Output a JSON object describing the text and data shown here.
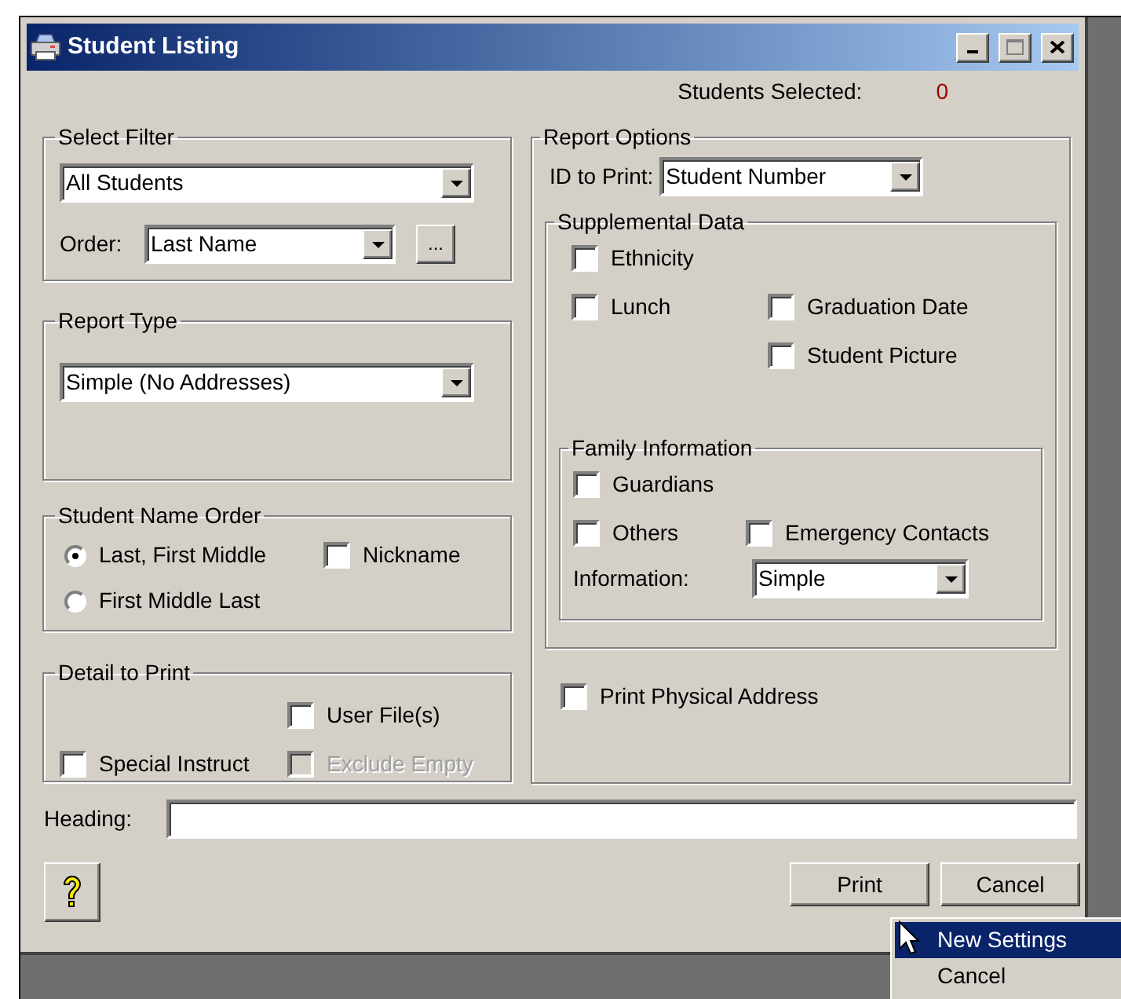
{
  "window": {
    "title": "Student Listing"
  },
  "students_selected": {
    "label": "Students Selected:",
    "value": "0"
  },
  "select_filter": {
    "title": "Select Filter",
    "filter": {
      "value": "All Students"
    },
    "order": {
      "label": "Order:",
      "value": "Last Name"
    },
    "browse_button": "..."
  },
  "report_type": {
    "title": "Report Type",
    "value": "Simple (No Addresses)"
  },
  "student_name_order": {
    "title": "Student Name Order",
    "options": [
      {
        "label": "Last, First Middle",
        "selected": true
      },
      {
        "label": "First Middle Last",
        "selected": false
      }
    ],
    "nickname": {
      "label": "Nickname",
      "checked": false
    }
  },
  "detail_to_print": {
    "title": "Detail to Print",
    "options": [
      {
        "label": "User File(s)",
        "checked": false,
        "disabled": false
      },
      {
        "label": "Special Instruct",
        "checked": false,
        "disabled": false
      },
      {
        "label": "Exclude Empty",
        "checked": false,
        "disabled": true
      }
    ]
  },
  "report_options": {
    "title": "Report Options",
    "id_to_print": {
      "label": "ID to Print:",
      "value": "Student Number"
    },
    "supplemental_data": {
      "title": "Supplemental Data",
      "options": [
        {
          "label": "Ethnicity",
          "checked": false
        },
        {
          "label": "Lunch",
          "checked": false
        },
        {
          "label": "Graduation Date",
          "checked": false
        },
        {
          "label": "Student Picture",
          "checked": false
        }
      ]
    },
    "family_information": {
      "title": "Family Information",
      "options": [
        {
          "label": "Guardians",
          "checked": false
        },
        {
          "label": "Others",
          "checked": false
        },
        {
          "label": "Emergency Contacts",
          "checked": false
        }
      ],
      "information": {
        "label": "Information:",
        "value": "Simple"
      }
    },
    "print_physical_address": {
      "label": "Print Physical Address",
      "checked": false
    }
  },
  "heading": {
    "label": "Heading:"
  },
  "buttons": [
    {
      "label": "Print"
    },
    {
      "label": "Cancel"
    }
  ],
  "context_menu": [
    {
      "label": "New Settings",
      "selected": true
    },
    {
      "label": "Cancel",
      "selected": false
    }
  ]
}
